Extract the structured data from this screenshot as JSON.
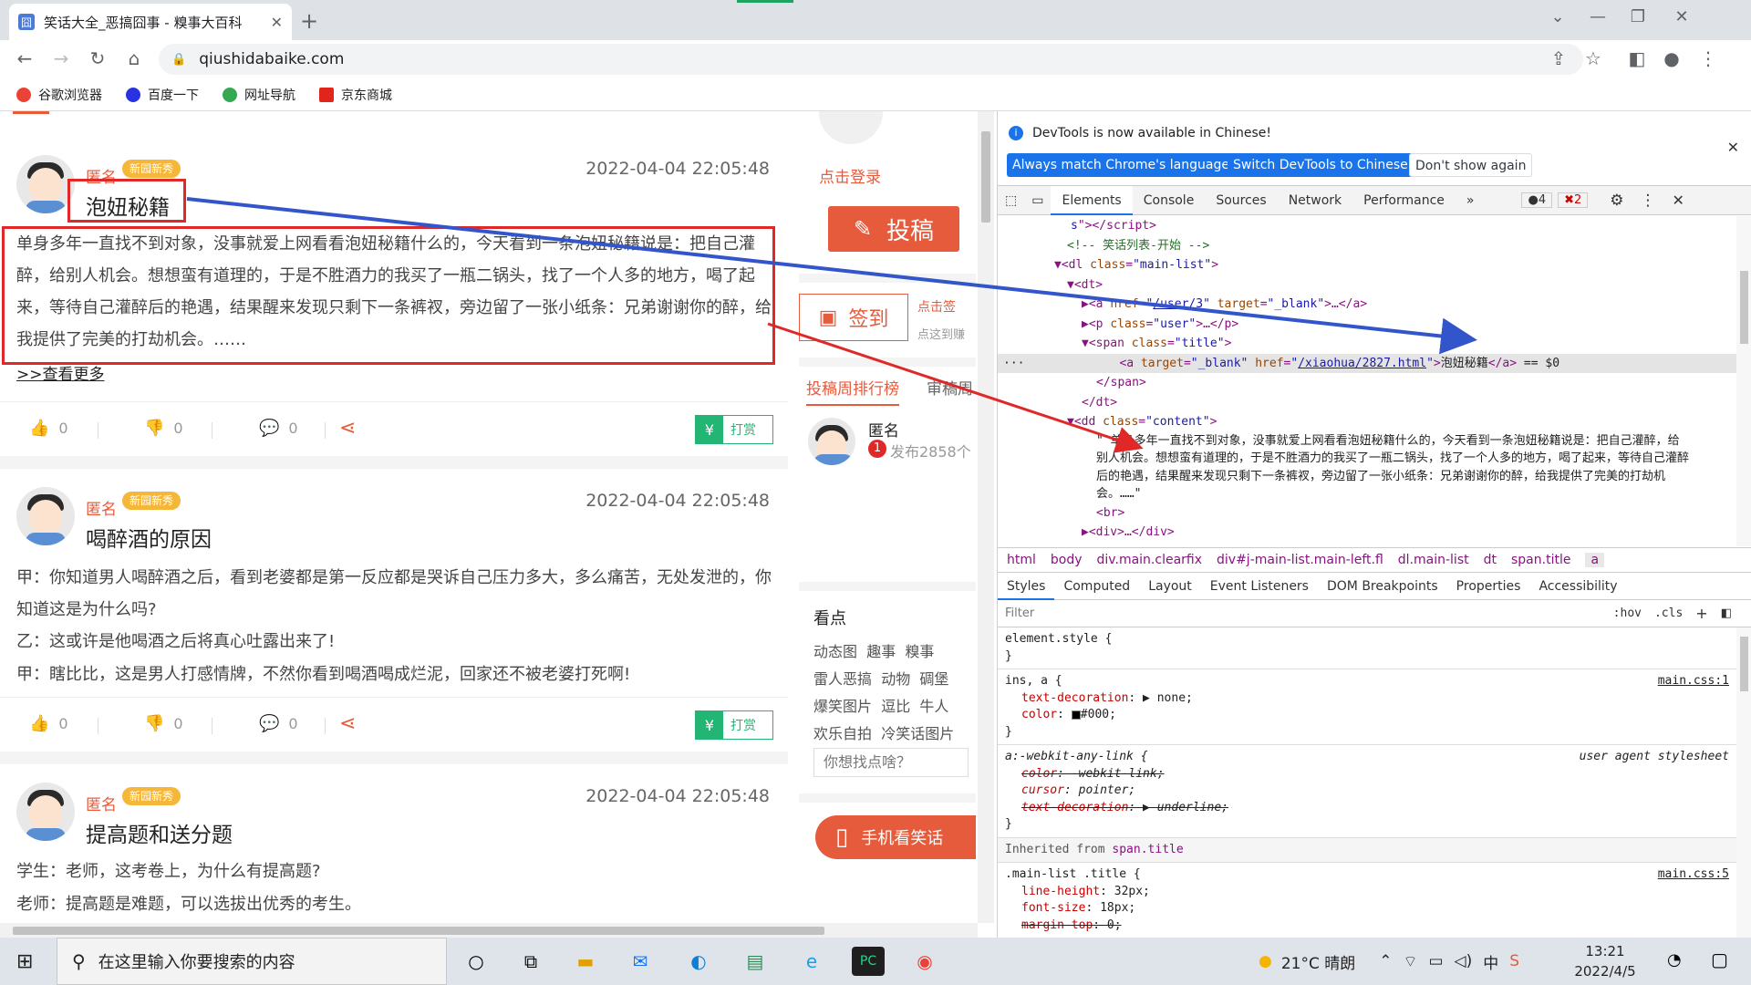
{
  "browser": {
    "tab_title": "笑话大全_恶搞囧事 - 糗事大百科",
    "tab_close": "✕",
    "new_tab": "+",
    "url": "qiushidabaike.com",
    "bookmarks": [
      {
        "label": "谷歌浏览器",
        "color": "#ea4335"
      },
      {
        "label": "百度一下",
        "color": "#2932e1"
      },
      {
        "label": "网址导航",
        "color": "#34a853"
      },
      {
        "label": "京东商城",
        "color": "#e1251b"
      }
    ]
  },
  "posts": [
    {
      "user": "匿名",
      "badge": "新园新秀",
      "date": "2022-04-04 22:05:48",
      "title": "泡妞秘籍",
      "content": "单身多年一直找不到对象，没事就爱上网看看泡妞秘籍什么的，今天看到一条泡妞秘籍说是：把自己灌醉，给别人机会。想想蛮有道理的，于是不胜酒力的我买了一瓶二锅头，找了一个人多的地方，喝了起来，等待自己灌醉后的艳遇，结果醒来发现只剩下一条裤衩，旁边留了一张小纸条：兄弟谢谢你的醉，给我提供了完美的打劫机会。……",
      "more": ">>查看更多",
      "likes": "0",
      "dislikes": "0",
      "comments": "0",
      "reward": "打赏"
    },
    {
      "user": "匿名",
      "badge": "新园新秀",
      "date": "2022-04-04 22:05:48",
      "title": "喝醉酒的原因",
      "lines": [
        "甲：你知道男人喝醉酒之后，看到老婆都是第一反应都是哭诉自己压力多大，多么痛苦，无处发泄的，你知道这是为什么吗?",
        "乙：这或许是他喝酒之后将真心吐露出来了!",
        "甲：瞎比比，这是男人打感情牌，不然你看到喝酒喝成烂泥，回家还不被老婆打死啊!"
      ],
      "likes": "0",
      "dislikes": "0",
      "comments": "0",
      "reward": "打赏"
    },
    {
      "user": "匿名",
      "badge": "新园新秀",
      "date": "2022-04-04 22:05:48",
      "title": "提高题和送分题",
      "lines": [
        "学生：老师，这考卷上，为什么有提高题?",
        "老师：提高题是难题，可以选拔出优秀的考生。"
      ]
    }
  ],
  "sidebar": {
    "login": "点击登录",
    "submit": "投稿",
    "signin": "签到",
    "signin_hint": "点击签",
    "signin_sub": "点这到赚",
    "rank_tab": "投稿周排行榜",
    "rank_tab2": "审稿周",
    "rank_user": "匿名",
    "rank_count": "发布2858个",
    "rank_num": "1",
    "hot_title": "看点",
    "hot_links": [
      [
        "动态图",
        "趣事",
        "糗事"
      ],
      [
        "雷人恶搞",
        "动物",
        "碉堡"
      ],
      [
        "爆笑图片",
        "逗比",
        "牛人"
      ],
      [
        "欢乐自拍",
        "冷笑话图片"
      ]
    ],
    "search_placeholder": "你想找点啥？",
    "mobile": "手机看笑话"
  },
  "devtools": {
    "info_msg": "DevTools is now available in Chinese!",
    "btn_match": "Always match Chrome's language",
    "btn_switch": "Switch DevTools to Chinese",
    "btn_dont": "Don't show again",
    "tabs": [
      "Elements",
      "Console",
      "Sources",
      "Network",
      "Performance",
      "»"
    ],
    "badge_msgs": "4",
    "badge_errors": "2",
    "crumbs": [
      "html",
      "body",
      "div.main.clearfix",
      "div#j-main-list.main-left.fl",
      "dl.main-list",
      "dt",
      "span.title",
      "a"
    ],
    "style_tabs": [
      "Styles",
      "Computed",
      "Layout",
      "Event Listeners",
      "DOM Breakpoints",
      "Properties",
      "Accessibility"
    ],
    "filter": "Filter",
    "hov": ":hov",
    "cls": ".cls",
    "selected_text": "泡妞秘籍",
    "dom_content": "\" 单身多年一直找不到对象，没事就爱上网看看泡妞秘籍什么的，今天看到一条泡妞秘籍说是：把自己灌醉，给别人机会。想想蛮有道理的，于是不胜酒力的我买了一瓶二锅头，找了一个人多的地方，喝了起来，等待自己灌醉后的艳遇，结果醒来发现只剩下一条裤衩，旁边留了一张小纸条：兄弟谢谢你的醉，给我提供了完美的打劫机会。……\"",
    "styles": {
      "element_style": "element.style {",
      "rule1_selector": "ins, a {",
      "rule1_src": "main.css:1",
      "rule2_selector": "a:-webkit-any-link {",
      "rule2_src": "user agent stylesheet",
      "inherited": "Inherited from",
      "inherited_el": "span.title",
      "rule3_selector": ".main-list .title {",
      "rule3_src": "main.css:5"
    }
  },
  "taskbar": {
    "search_placeholder": "在这里输入你要搜索的内容",
    "weather": "21°C 晴朗",
    "time": "13:21",
    "date": "2022/4/5"
  },
  "colors": {
    "accent": "#e55b3c",
    "annotation_red": "#e02828",
    "annotation_blue": "#3355cc"
  }
}
